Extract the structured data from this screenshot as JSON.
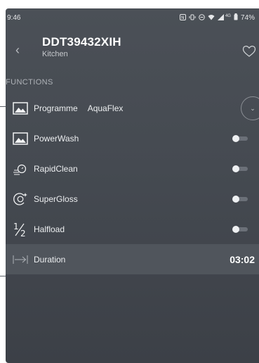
{
  "status_bar": {
    "time": "9:46",
    "battery": "74%",
    "network": "4G"
  },
  "header": {
    "title": "DDT39432XIH",
    "subtitle": "Kitchen"
  },
  "functions": {
    "section_label": "FUNCTIONS",
    "programme": {
      "label": "Programme",
      "value": "AquaFlex"
    },
    "items": [
      {
        "label": "PowerWash",
        "icon": "image-icon",
        "enabled": false
      },
      {
        "label": "RapidClean",
        "icon": "rapid-clean-icon",
        "enabled": false
      },
      {
        "label": "SuperGloss",
        "icon": "super-gloss-icon",
        "enabled": false
      },
      {
        "label": "Halfload",
        "icon": "half-load-icon",
        "enabled": false
      }
    ],
    "duration": {
      "label": "Duration",
      "value": "03:02"
    }
  },
  "colors": {
    "panel": "#454a51",
    "duration_bg": "#50555c",
    "toggle_knob": "#eef0f2"
  }
}
